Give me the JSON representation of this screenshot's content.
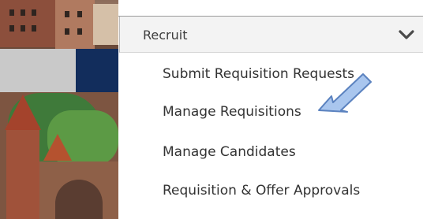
{
  "menu": {
    "section_label": "Recruit",
    "items": [
      {
        "label": "Submit Requisition Requests"
      },
      {
        "label": "Manage Requisitions"
      },
      {
        "label": "Manage Candidates"
      },
      {
        "label": "Requisition & Offer Approvals"
      }
    ]
  },
  "icons": {
    "chevron": "chevron-down-icon",
    "pointer": "arrow-pointer-icon"
  },
  "colors": {
    "arrow_fill": "#a9c6ee",
    "arrow_stroke": "#5b82bf",
    "header_bg": "#f3f3f3",
    "text": "#333333"
  }
}
